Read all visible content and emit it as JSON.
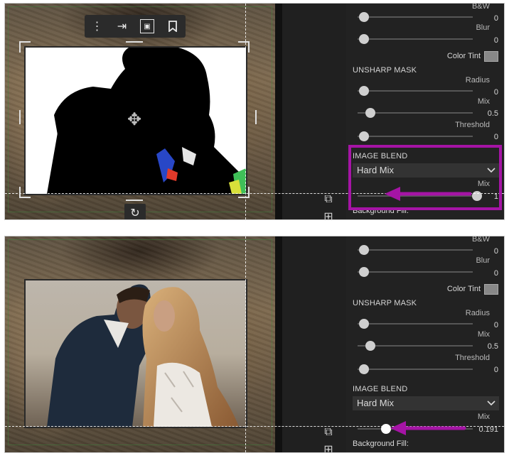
{
  "toolbar": {
    "icons": [
      "more-vertical-icon",
      "compare-icon",
      "fit-frame-icon",
      "bookmark-icon"
    ]
  },
  "properties": {
    "bw_label": "B&W",
    "blur_label": "Blur",
    "color_tint_label": "Color Tint",
    "unsharp_mask_title": "UNSHARP MASK",
    "radius_label": "Radius",
    "mix_label": "Mix",
    "threshold_label": "Threshold",
    "image_blend_title": "IMAGE BLEND",
    "blend_mode": "Hard Mix",
    "background_fill_label": "Background Fill:"
  },
  "panels": [
    {
      "bw_value": "0",
      "blur_value": "0",
      "radius_value": "0",
      "unsharp_mix_value": "0.5",
      "threshold_value": "0",
      "blend_mix_value": "1",
      "blend_mix_fraction": 1.0,
      "unsharp_mix_fraction": 0.1
    },
    {
      "bw_value": "0",
      "blur_value": "0",
      "radius_value": "0",
      "unsharp_mix_value": "0.5",
      "threshold_value": "0",
      "blend_mix_value": "0.191",
      "blend_mix_fraction": 0.191,
      "unsharp_mix_fraction": 0.1
    }
  ],
  "colors": {
    "highlight": "#a514a5",
    "arrow": "#a514a5",
    "panel_bg": "#222222"
  }
}
